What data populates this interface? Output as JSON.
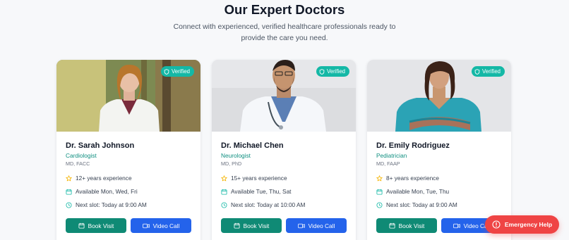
{
  "section": {
    "title": "Our Expert Doctors",
    "subtitle": "Connect with experienced, verified healthcare professionals ready to provide the care you need."
  },
  "doctors": [
    {
      "badge": "Verified",
      "name": "Dr. Sarah Johnson",
      "specialty": "Cardiologist",
      "credentials": "MD, FACC",
      "experience": "12+ years experience",
      "availability": "Available Mon, Wed, Fri",
      "next_slot": "Next slot: Today at 9:00 AM",
      "book_label": "Book Visit",
      "video_label": "Video Call"
    },
    {
      "badge": "Verified",
      "name": "Dr. Michael Chen",
      "specialty": "Neurologist",
      "credentials": "MD, PhD",
      "experience": "15+ years experience",
      "availability": "Available Tue, Thu, Sat",
      "next_slot": "Next slot: Today at 10:00 AM",
      "book_label": "Book Visit",
      "video_label": "Video Call"
    },
    {
      "badge": "Verified",
      "name": "Dr. Emily Rodriguez",
      "specialty": "Pediatrician",
      "credentials": "MD, FAAP",
      "experience": "8+ years experience",
      "availability": "Available Mon, Tue, Thu",
      "next_slot": "Next slot: Today at 9:00 AM",
      "book_label": "Book Visit",
      "video_label": "Video Call"
    }
  ],
  "emergency": {
    "label": "Emergency Help"
  },
  "icons": {
    "verified": "shield-icon",
    "experience": "star-icon",
    "availability": "calendar-icon",
    "next_slot": "clock-icon",
    "book": "calendar-icon",
    "video": "video-icon",
    "emergency": "alert-circle-icon"
  },
  "colors": {
    "primary_teal": "#0f8a75",
    "badge_teal": "#14b8a6",
    "specialty_teal": "#0f8f80",
    "video_blue": "#2463eb",
    "star_gold": "#f5b400",
    "emergency_red": "#ef4444"
  }
}
